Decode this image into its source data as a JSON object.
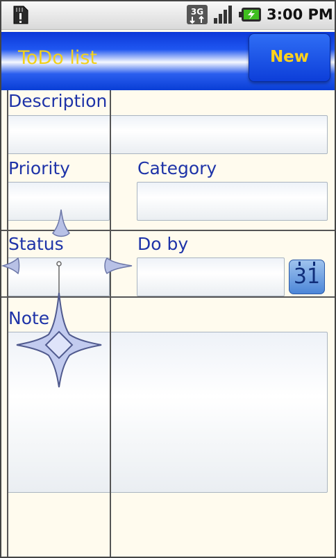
{
  "status_bar": {
    "time": "3:00 PM",
    "network": "3G",
    "icons": [
      "sd-card-notification-icon",
      "3g-data-icon",
      "signal-strength-icon",
      "battery-charging-icon"
    ]
  },
  "app_bar": {
    "title": "ToDo list",
    "new_button_label": "New"
  },
  "form": {
    "description_label": "Description",
    "description_value": "",
    "priority_label": "Priority",
    "priority_value": "",
    "category_label": "Category",
    "category_value": "",
    "status_label": "Status",
    "status_value": "",
    "do_by_label": "Do by",
    "do_by_value": "",
    "calendar_button_label": "31",
    "note_label": "Note",
    "note_value": ""
  },
  "colors": {
    "label_blue": "#1e33a8",
    "title_yellow": "#f3d11a",
    "background": "#fffbee",
    "appbar_blue": "#1f56f0"
  }
}
